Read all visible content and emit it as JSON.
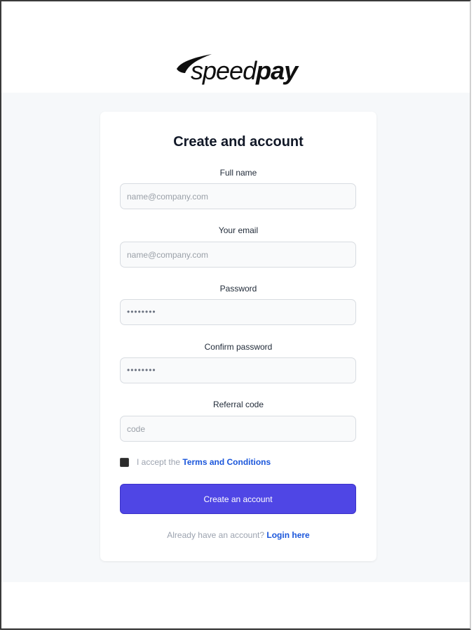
{
  "brand": {
    "prefix": "speed",
    "suffix": "pay",
    "icon": "swoosh-icon"
  },
  "form": {
    "title": "Create and account",
    "fields": [
      {
        "label": "Full name",
        "placeholder": "name@company.com",
        "value": ""
      },
      {
        "label": "Your email",
        "placeholder": "name@company.com",
        "value": ""
      },
      {
        "label": "Password",
        "placeholder": "",
        "value": "••••••••"
      },
      {
        "label": "Confirm password",
        "placeholder": "",
        "value": "••••••••"
      },
      {
        "label": "Referral code",
        "placeholder": "code",
        "value": ""
      }
    ],
    "terms": {
      "prefix": "I accept the",
      "link": "Terms and Conditions",
      "checked": false
    },
    "submit_label": "Create an account",
    "login": {
      "prompt": "Already have an account?",
      "link": "Login here"
    }
  },
  "colors": {
    "accent": "#4f46e5",
    "link": "#1a56db",
    "background": "#f6f8fa"
  }
}
